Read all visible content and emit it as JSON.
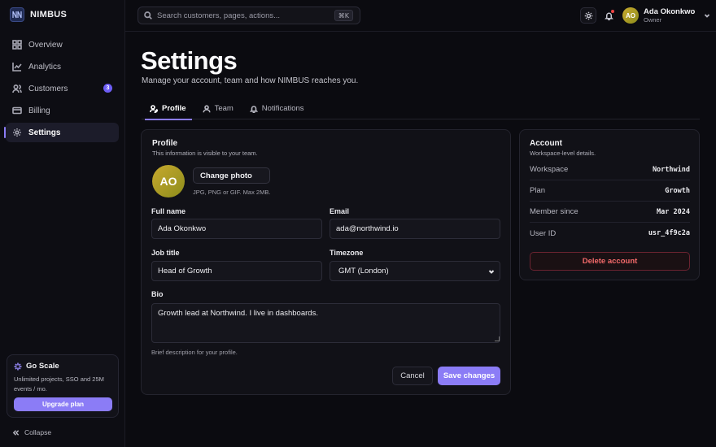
{
  "brand": {
    "logo_text": "N",
    "name": "NIMBUS"
  },
  "sidebar": {
    "items": [
      {
        "label": "Overview",
        "icon": "grid-icon"
      },
      {
        "label": "Analytics",
        "icon": "chart-line-icon"
      },
      {
        "label": "Customers",
        "icon": "users-icon",
        "badge": "3"
      },
      {
        "label": "Billing",
        "icon": "credit-card-icon"
      },
      {
        "label": "Settings",
        "icon": "gear-icon",
        "active": true
      }
    ],
    "promo": {
      "title": "Go Scale",
      "text": "Unlimited projects, SSO and 25M events / mo.",
      "button": "Upgrade plan"
    },
    "collapse_label": "Collapse"
  },
  "topbar": {
    "search_placeholder": "Search customers, pages, actions...",
    "search_shortcut": "⌘K",
    "user": {
      "initials": "AO",
      "name": "Ada Okonkwo",
      "role": "Owner"
    }
  },
  "page": {
    "title": "Settings",
    "subtitle": "Manage your account, team and how NIMBUS reaches you."
  },
  "tabs": [
    {
      "label": "Profile",
      "icon": "user-edit-icon",
      "active": true
    },
    {
      "label": "Team",
      "icon": "team-icon"
    },
    {
      "label": "Notifications",
      "icon": "bell-icon"
    }
  ],
  "profile": {
    "title": "Profile",
    "subtitle": "This information is visible to your team.",
    "avatar_initials": "AO",
    "change_photo": "Change photo",
    "photo_hint": "JPG, PNG or GIF. Max 2MB.",
    "full_name_label": "Full name",
    "full_name": "Ada Okonkwo",
    "email_label": "Email",
    "email": "ada@northwind.io",
    "job_title_label": "Job title",
    "job_title": "Head of Growth",
    "timezone_label": "Timezone",
    "timezone": "GMT (London)",
    "bio_label": "Bio",
    "bio": "Growth lead at Northwind. I live in dashboards.",
    "bio_hint": "Brief description for your profile.",
    "cancel": "Cancel",
    "save": "Save changes"
  },
  "account": {
    "title": "Account",
    "subtitle": "Workspace-level details.",
    "rows": [
      {
        "key": "Workspace",
        "value": "Northwind"
      },
      {
        "key": "Plan",
        "value": "Growth"
      },
      {
        "key": "Member since",
        "value": "Mar 2024"
      },
      {
        "key": "User ID",
        "value": "usr_4f9c2a"
      }
    ],
    "delete": "Delete account"
  },
  "colors": {
    "accent": "#8b7cf6",
    "danger": "#f46a6a",
    "background": "#0b0b10"
  }
}
